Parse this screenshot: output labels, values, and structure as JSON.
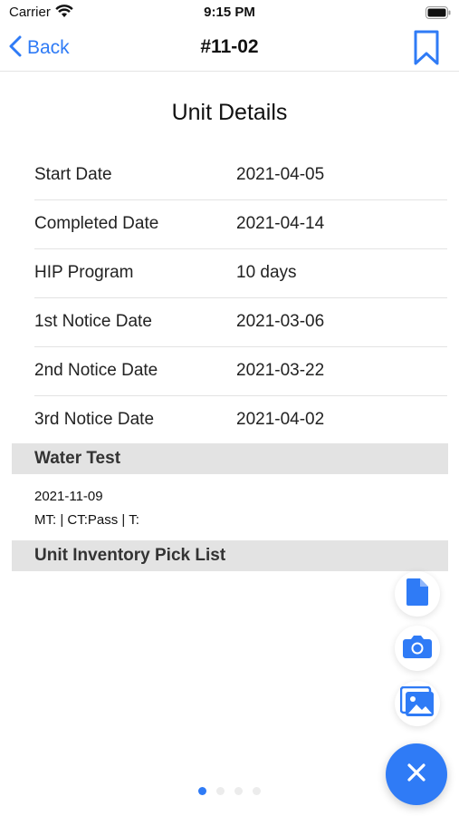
{
  "status_bar": {
    "carrier": "Carrier",
    "time": "9:15 PM"
  },
  "nav": {
    "back_label": "Back",
    "title": "#11-02"
  },
  "unit_details": {
    "title": "Unit Details",
    "rows": [
      {
        "label": "Start Date",
        "value": "2021-04-05"
      },
      {
        "label": "Completed Date",
        "value": "2021-04-14"
      },
      {
        "label": "HIP Program",
        "value": "10 days"
      },
      {
        "label": "1st Notice Date",
        "value": "2021-03-06"
      },
      {
        "label": "2nd Notice Date",
        "value": "2021-03-22"
      },
      {
        "label": "3rd Notice Date",
        "value": "2021-04-02"
      }
    ]
  },
  "water_test": {
    "header": "Water Test",
    "date": "2021-11-09",
    "result": "MT: | CT:Pass | T:"
  },
  "inventory": {
    "header": "Unit Inventory Pick List"
  },
  "actions": {
    "document_icon": "document-icon",
    "camera_icon": "camera-icon",
    "gallery_icon": "photo-gallery-icon",
    "close_icon": "close-icon"
  },
  "pager": {
    "page_count": 4,
    "current_page": 1
  },
  "colors": {
    "accent": "#2f7bf6",
    "section_header_bg": "#e3e3e3",
    "divider": "#e3e3e3"
  }
}
